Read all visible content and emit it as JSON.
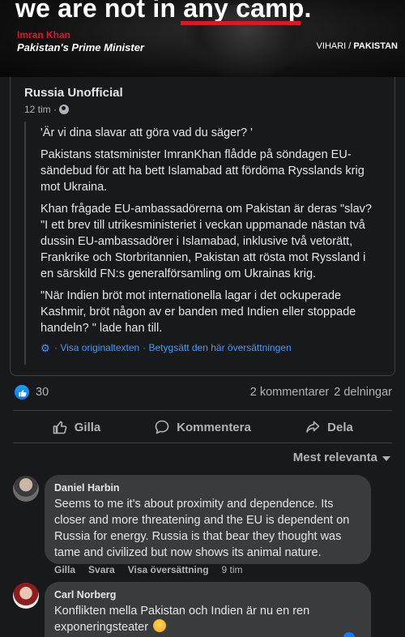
{
  "image": {
    "headline": "we are not in any camp.",
    "name": "Imran Khan",
    "role": "Pakistan's Prime Minister",
    "brand_prefix": "VIHARI",
    "brand_sep": " / ",
    "brand_suffix": "PAKISTAN",
    "accent_color": "#e0152a"
  },
  "post": {
    "author": "Russia Unofficial",
    "time": "12 tim ·",
    "paragraphs": [
      "'Är vi dina slavar att göra vad du säger? '",
      "Pakistans statsminister ImranKhan flådde på söndagen EU-sändebud för att ha bett Islamabad att fördöma Rysslands krig mot Ukraina.",
      "Khan frågade EU-ambassadörerna om Pakistan är deras \"slav? \"I ett brev till utrikesministeriet i veckan uppmanade nästan två dussin EU-ambassadörer i Islamabad, inklusive två vetorätt, Frankrike och Storbritannien, Pakistan att rösta mot Ryssland i en särskild FN:s generalförsamling om Ukrainas krig.",
      "\"När Indien bröt mot internationella lagar i det ockuperade Kashmir, bröt någon av er banden med Indien eller stoppade handeln? \" lade han till."
    ],
    "translate_original": "· Visa originaltexten",
    "translate_rate": "· Betygsätt den här översättningen"
  },
  "stats": {
    "reactions": "30",
    "comments": "2 kommentarer",
    "shares": "2 delningar"
  },
  "actions": {
    "like": "Gilla",
    "comment": "Kommentera",
    "share": "Dela"
  },
  "sort_label": "Mest relevanta",
  "comments": [
    {
      "name": "Daniel Harbin",
      "text": "Seems to me it's about proximity and dependence. Its closer and more threatening and the EU is dependent on Russia for energy. Russia is that bear they thought was tame and civilized but now shows its animal nature.",
      "like": "Gilla",
      "reply": "Svara",
      "see_translation": "Visa översättning",
      "time": "9 tim"
    },
    {
      "name": "Carl Norberg",
      "text": "Konflikten mella Pakistan och Indien är nu en ren exponeringsteater"
    }
  ],
  "colors": {
    "background": "#18191a",
    "bubble": "#3a3b3c",
    "link": "#4599ff",
    "like_blue": "#1877f2"
  }
}
